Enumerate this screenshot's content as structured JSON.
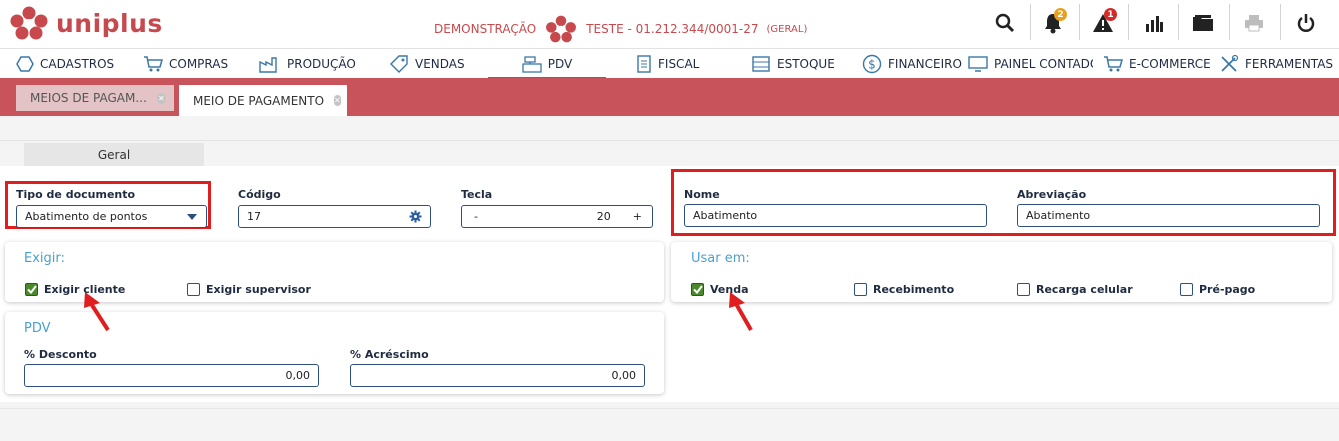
{
  "header": {
    "logo_text": "uniplus",
    "company_prefix": "DEMONSTRAÇÃO",
    "company_name": "TESTE - 01.212.344/0001-27",
    "company_suffix": "(GERAL)",
    "notifications_count": "2",
    "alerts_count": "1",
    "colors": {
      "brand": "#c8494d",
      "badge_notifications": "#e8a020",
      "badge_alerts": "#d42a2a"
    }
  },
  "nav": {
    "items": [
      {
        "label": "CADASTROS",
        "icon": "hexagon-icon"
      },
      {
        "label": "COMPRAS",
        "icon": "cart-icon"
      },
      {
        "label": "PRODUÇÃO",
        "icon": "factory-icon"
      },
      {
        "label": "VENDAS",
        "icon": "tag-icon"
      },
      {
        "label": "PDV",
        "icon": "register-icon"
      },
      {
        "label": "FISCAL",
        "icon": "document-icon"
      },
      {
        "label": "ESTOQUE",
        "icon": "warehouse-icon"
      },
      {
        "label": "FINANCEIRO",
        "icon": "dollar-icon"
      },
      {
        "label": "PAINEL CONTADOR",
        "icon": "computer-icon"
      },
      {
        "label": "E-COMMERCE",
        "icon": "cart-icon"
      },
      {
        "label": "FERRAMENTAS",
        "icon": "tools-icon"
      }
    ],
    "active": "PDV"
  },
  "tabs": {
    "inactive_label": "MEIOS DE PAGAM...",
    "active_label": "MEIO DE PAGAMENTO"
  },
  "subtab": {
    "label": "Geral"
  },
  "form": {
    "tipo_label": "Tipo de documento",
    "tipo_value": "Abatimento de pontos",
    "codigo_label": "Código",
    "codigo_value": "17",
    "tecla_label": "Tecla",
    "tecla_minus": "-",
    "tecla_value": "20",
    "tecla_plus": "+",
    "nome_label": "Nome",
    "nome_value": "Abatimento",
    "abrev_label": "Abreviação",
    "abrev_value": "Abatimento"
  },
  "exigir": {
    "title": "Exigir:",
    "cliente_label": "Exigir cliente",
    "cliente_checked": true,
    "supervisor_label": "Exigir supervisor",
    "supervisor_checked": false
  },
  "usar_em": {
    "title": "Usar em:",
    "venda_label": "Venda",
    "venda_checked": true,
    "recebimento_label": "Recebimento",
    "recebimento_checked": false,
    "recarga_label": "Recarga celular",
    "recarga_checked": false,
    "prepago_label": "Pré-pago",
    "prepago_checked": false
  },
  "pdv": {
    "title": "PDV",
    "desconto_label": "% Desconto",
    "desconto_value": "0,00",
    "acrescimo_label": "% Acréscimo",
    "acrescimo_value": "0,00"
  }
}
